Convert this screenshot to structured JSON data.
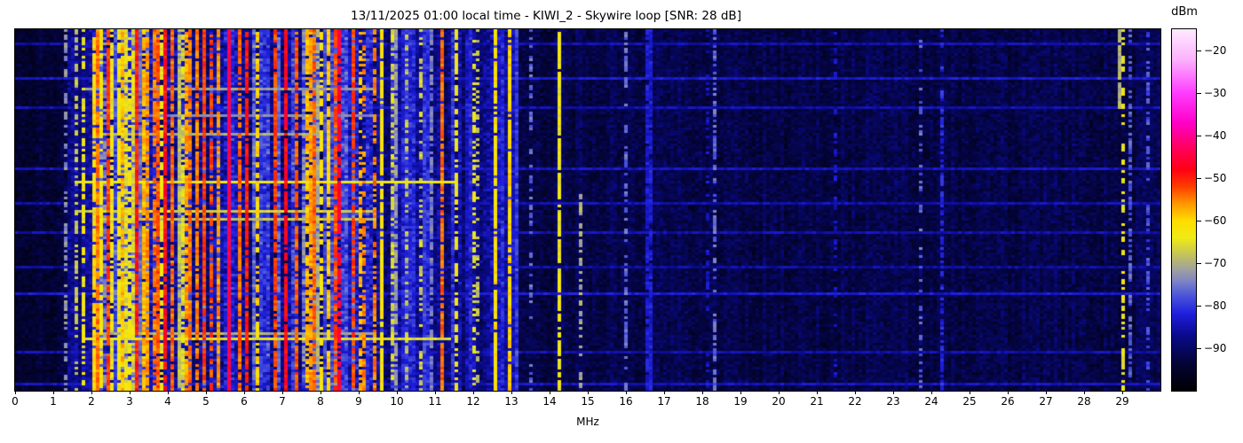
{
  "figure": {
    "background": "#ffffff",
    "text_color": "#000000"
  },
  "chart_data": {
    "type": "heatmap",
    "title": "13/11/2025 01:00 local time - KIWI_2 - Skywire loop [SNR: 28 dB]",
    "xlabel": "MHz",
    "x_range_mhz": [
      0,
      30
    ],
    "x_ticks": [
      0,
      1,
      2,
      3,
      4,
      5,
      6,
      7,
      8,
      9,
      10,
      11,
      12,
      13,
      14,
      15,
      16,
      17,
      18,
      19,
      20,
      21,
      22,
      23,
      24,
      25,
      26,
      27,
      28,
      29
    ],
    "y_axis_meaning": "time scan lines (unlabeled)",
    "colorbar": {
      "label": "dBm",
      "tick_labels": [
        "−20",
        "−30",
        "−40",
        "−50",
        "−60",
        "−70",
        "−80",
        "−90"
      ],
      "tick_values": [
        -20,
        -30,
        -40,
        -50,
        -60,
        -70,
        -80,
        -90
      ],
      "vmin": -100,
      "vmax": -15,
      "stops": [
        {
          "v": -100,
          "c": "#000000"
        },
        {
          "v": -93,
          "c": "#04043c"
        },
        {
          "v": -87,
          "c": "#0a0a8c"
        },
        {
          "v": -82,
          "c": "#1e1edc"
        },
        {
          "v": -78,
          "c": "#4650dc"
        },
        {
          "v": -74,
          "c": "#8287c3"
        },
        {
          "v": -71,
          "c": "#a5a596"
        },
        {
          "v": -68,
          "c": "#c3c35a"
        },
        {
          "v": -64,
          "c": "#f0eb14"
        },
        {
          "v": -60,
          "c": "#ffdc00"
        },
        {
          "v": -56,
          "c": "#ff9600"
        },
        {
          "v": -52,
          "c": "#ff3c00"
        },
        {
          "v": -48,
          "c": "#ff0014"
        },
        {
          "v": -43,
          "c": "#ff005a"
        },
        {
          "v": -37,
          "c": "#ff00c8"
        },
        {
          "v": -30,
          "c": "#ff3cff"
        },
        {
          "v": -22,
          "c": "#fcb4fc"
        },
        {
          "v": -15,
          "c": "#ffeaff"
        }
      ]
    },
    "regions": [
      {
        "f0": 0.0,
        "f1": 1.35,
        "base": -94,
        "noise": 3.5,
        "col_var": 1.5
      },
      {
        "f0": 1.35,
        "f1": 2.0,
        "base": -88,
        "noise": 4.5,
        "col_var": 3
      },
      {
        "f0": 2.0,
        "f1": 9.4,
        "base": -83,
        "noise": 6,
        "col_var": 7
      },
      {
        "f0": 9.4,
        "f1": 13.2,
        "base": -85,
        "noise": 5,
        "col_var": 5
      },
      {
        "f0": 13.2,
        "f1": 30.0,
        "base": -92,
        "noise": 3.8,
        "col_var": 1.5
      }
    ],
    "carrier_fill": [
      {
        "f0": 1.5,
        "f1": 2.0,
        "p": 0.18,
        "s_min": -72,
        "s_max": -64,
        "d_min": 0.3,
        "d_max": 0.6
      },
      {
        "f0": 2.0,
        "f1": 9.4,
        "p": 0.55,
        "s_min": -79,
        "s_max": -50,
        "d_min": 0.45,
        "d_max": 0.95
      },
      {
        "f0": 9.4,
        "f1": 13.2,
        "p": 0.12,
        "s_min": -75,
        "s_max": -62,
        "d_min": 0.35,
        "d_max": 0.8
      },
      {
        "f0": 13.2,
        "f1": 30.0,
        "p": 0.03,
        "s_min": -86,
        "s_max": -76,
        "d_min": 0.3,
        "d_max": 0.6
      }
    ],
    "carriers": [
      {
        "f": 1.35,
        "s": -73,
        "d": 0.45
      },
      {
        "f": 1.62,
        "s": -68,
        "d": 0.5
      },
      {
        "f": 1.77,
        "s": -64,
        "d": 0.6
      },
      {
        "f": 2.05,
        "s": -60,
        "d": 0.8
      },
      {
        "f": 2.21,
        "s": -55,
        "d": 0.85
      },
      {
        "f": 2.45,
        "s": -52,
        "d": 0.9
      },
      {
        "f": 2.85,
        "s": -58,
        "d": 0.8
      },
      {
        "f": 3.2,
        "s": -50,
        "d": 0.9
      },
      {
        "f": 3.5,
        "s": -56,
        "d": 0.85
      },
      {
        "f": 3.75,
        "s": -53,
        "d": 0.9
      },
      {
        "f": 3.95,
        "s": -49,
        "d": 0.92
      },
      {
        "f": 4.15,
        "s": -54,
        "d": 0.85
      },
      {
        "f": 4.5,
        "s": -57,
        "d": 0.8
      },
      {
        "f": 4.8,
        "s": -55,
        "d": 0.85
      },
      {
        "f": 5.0,
        "s": -52,
        "d": 0.9
      },
      {
        "f": 5.35,
        "s": -56,
        "d": 0.8
      },
      {
        "f": 5.65,
        "s": -44,
        "d": 0.98
      },
      {
        "f": 5.9,
        "s": -54,
        "d": 0.85
      },
      {
        "f": 6.07,
        "s": -50,
        "d": 0.9
      },
      {
        "f": 6.35,
        "s": -60,
        "d": 0.7
      },
      {
        "f": 6.8,
        "s": -52,
        "d": 0.85
      },
      {
        "f": 7.1,
        "s": -48,
        "d": 0.9
      },
      {
        "f": 7.35,
        "s": -53,
        "d": 0.85
      },
      {
        "f": 7.7,
        "s": -58,
        "d": 0.7
      },
      {
        "f": 8.0,
        "s": -62,
        "d": 0.6
      },
      {
        "f": 8.5,
        "s": -46,
        "d": 0.8
      },
      {
        "f": 8.85,
        "s": -52,
        "d": 0.75
      },
      {
        "f": 9.1,
        "s": -58,
        "d": 0.6
      },
      {
        "f": 9.4,
        "s": -55,
        "d": 0.7
      },
      {
        "f": 9.62,
        "s": -62,
        "d": 0.9
      },
      {
        "f": 9.9,
        "s": -66,
        "d": 0.5
      },
      {
        "f": 10.3,
        "s": -68,
        "d": 0.45
      },
      {
        "f": 10.65,
        "s": -67,
        "d": 0.4
      },
      {
        "f": 11.17,
        "s": -54,
        "d": 0.85
      },
      {
        "f": 11.6,
        "s": -63,
        "d": 0.6
      },
      {
        "f": 12.1,
        "s": -68,
        "d": 0.4
      },
      {
        "f": 12.55,
        "s": -61,
        "d": 0.9
      },
      {
        "f": 12.97,
        "s": -60,
        "d": 0.92
      },
      {
        "f": 13.55,
        "s": -76,
        "d": 0.3
      },
      {
        "f": 14.25,
        "s": -64,
        "d": 0.85
      },
      {
        "f": 14.8,
        "s": -70,
        "d": 0.5,
        "y0": 0.45,
        "y1": 1
      },
      {
        "f": 16.0,
        "s": -76,
        "d": 0.5
      },
      {
        "f": 16.6,
        "s": -83,
        "d": 0.9,
        "w": 2
      },
      {
        "f": 18.2,
        "s": -84,
        "d": 0.4
      },
      {
        "f": 21.5,
        "s": -84,
        "d": 0.35
      },
      {
        "f": 28.9,
        "s": -70,
        "d": 0.95,
        "y0": 0,
        "y1": 0.22
      },
      {
        "f": 29.0,
        "s": -64,
        "d": 0.45
      },
      {
        "f": 29.2,
        "s": -77,
        "d": 0.55
      }
    ],
    "streaks": [
      {
        "y": 0.165,
        "f0": 1.8,
        "f1": 9.4,
        "level": -72
      },
      {
        "y": 0.235,
        "f0": 2.0,
        "f1": 9.4,
        "level": -74
      },
      {
        "y": 0.29,
        "f0": 2.0,
        "f1": 8.0,
        "level": -70
      },
      {
        "y": 0.42,
        "f0": 1.6,
        "f1": 11.6,
        "level": -64
      },
      {
        "y": 0.5,
        "f0": 1.6,
        "f1": 9.5,
        "level": -66
      },
      {
        "y": 0.525,
        "f0": 2.0,
        "f1": 9.5,
        "level": -68
      },
      {
        "y": 0.835,
        "f0": 2.0,
        "f1": 9.5,
        "level": -70
      },
      {
        "y": 0.85,
        "f0": 1.8,
        "f1": 11.4,
        "level": -65
      },
      {
        "y": 0.04,
        "f0": 0,
        "f1": 30,
        "level": -85
      },
      {
        "y": 0.13,
        "f0": 0,
        "f1": 30,
        "level": -83
      },
      {
        "y": 0.21,
        "f0": 0,
        "f1": 30,
        "level": -85
      },
      {
        "y": 0.38,
        "f0": 0,
        "f1": 30,
        "level": -84
      },
      {
        "y": 0.475,
        "f0": 0,
        "f1": 30,
        "level": -85
      },
      {
        "y": 0.56,
        "f0": 0,
        "f1": 30,
        "level": -85
      },
      {
        "y": 0.655,
        "f0": 0,
        "f1": 30,
        "level": -86
      },
      {
        "y": 0.73,
        "f0": 0,
        "f1": 30,
        "level": -83
      },
      {
        "y": 0.89,
        "f0": 0,
        "f1": 30,
        "level": -85
      },
      {
        "y": 0.975,
        "f0": 0,
        "f1": 30,
        "level": -84
      }
    ],
    "render": {
      "seed": 7,
      "cols": 323,
      "rows": 136
    }
  }
}
